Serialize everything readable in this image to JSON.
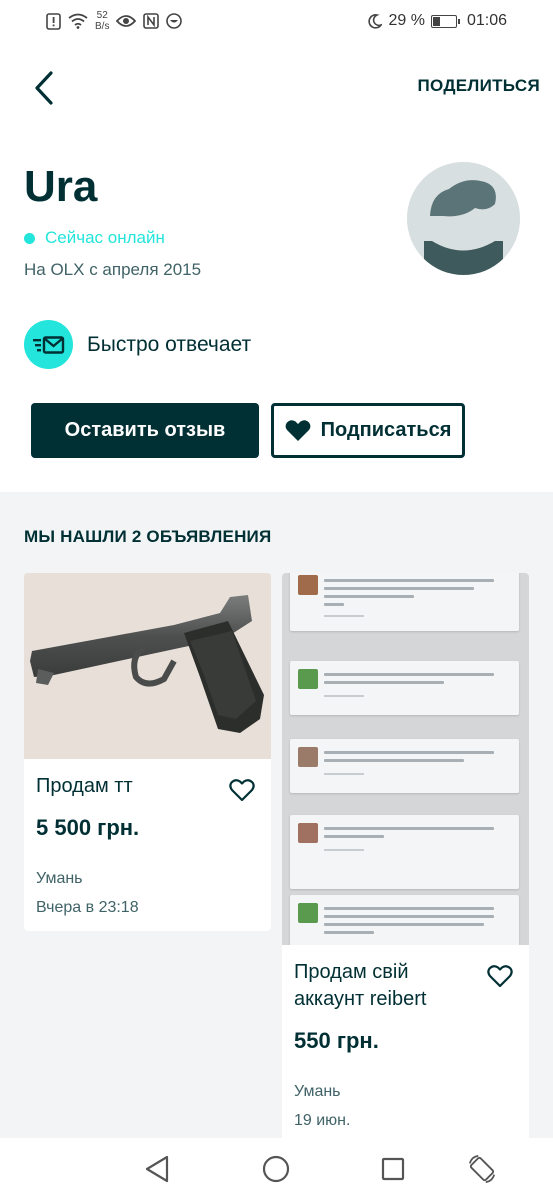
{
  "status_bar": {
    "speed_value": "52",
    "speed_unit": "B/s",
    "battery_percent": "29 %",
    "battery_level": 0.29,
    "time": "01:06"
  },
  "header": {
    "back_icon": "chevron-left-icon",
    "share_label": "ПОДЕЛИТЬСЯ"
  },
  "profile": {
    "name": "Ura",
    "online_status": "Сейчас онлайн",
    "member_since": "На OLX с апреля 2015",
    "fast_reply_label": "Быстро отвечает",
    "accent_color": "#23e5db"
  },
  "actions": {
    "review_label": "Оставить отзыв",
    "follow_label": "Подписаться"
  },
  "listings": {
    "header": "МЫ НАШЛИ 2 ОБЪЯВЛЕНИЯ",
    "items": [
      {
        "title": "Продам тт",
        "price": "5 500 грн.",
        "city": "Умань",
        "date": "Вчера в 23:18"
      },
      {
        "title": "Продам свій аккаунт reibert",
        "price": "550 грн.",
        "city": "Умань",
        "date": "19 июн."
      }
    ]
  },
  "colors": {
    "primary": "#002f34",
    "accent": "#23e5db",
    "secondary_text": "#406367",
    "background": "#f2f4f5"
  }
}
